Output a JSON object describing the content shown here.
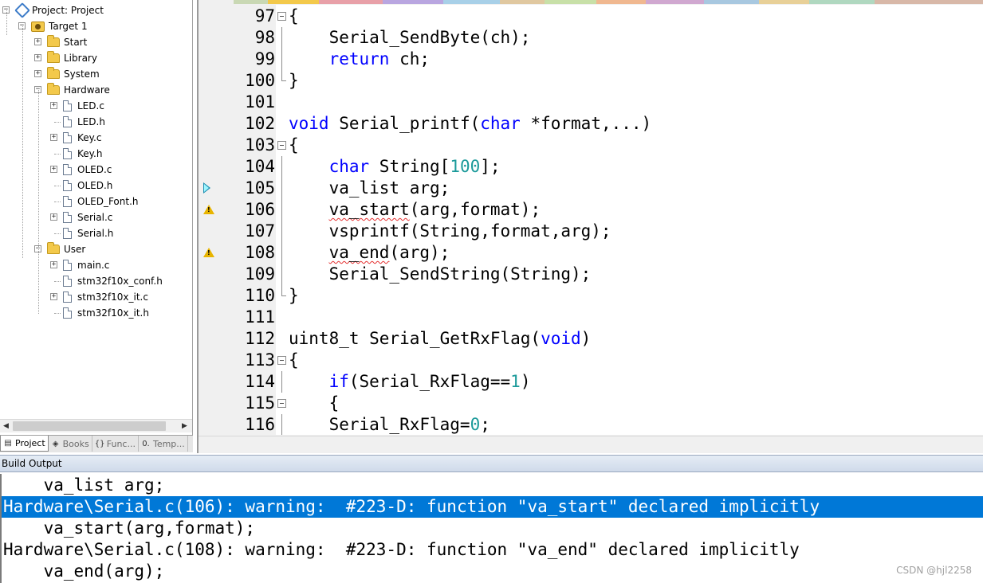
{
  "project_tree": {
    "items": [
      {
        "label": "Project: Project",
        "type": "project",
        "level": 0,
        "expander": "minus"
      },
      {
        "label": "Target 1",
        "type": "target",
        "level": 1,
        "expander": "minus"
      },
      {
        "label": "Start",
        "type": "folder",
        "level": 2,
        "expander": "plus"
      },
      {
        "label": "Library",
        "type": "folder",
        "level": 2,
        "expander": "plus"
      },
      {
        "label": "System",
        "type": "folder",
        "level": 2,
        "expander": "plus"
      },
      {
        "label": "Hardware",
        "type": "folder-open",
        "level": 2,
        "expander": "minus"
      },
      {
        "label": "LED.c",
        "type": "file",
        "level": 3,
        "expander": "plus"
      },
      {
        "label": "LED.h",
        "type": "file",
        "level": 3,
        "expander": "none"
      },
      {
        "label": "Key.c",
        "type": "file",
        "level": 3,
        "expander": "plus"
      },
      {
        "label": "Key.h",
        "type": "file",
        "level": 3,
        "expander": "none"
      },
      {
        "label": "OLED.c",
        "type": "file",
        "level": 3,
        "expander": "plus"
      },
      {
        "label": "OLED.h",
        "type": "file",
        "level": 3,
        "expander": "none"
      },
      {
        "label": "OLED_Font.h",
        "type": "file",
        "level": 3,
        "expander": "none"
      },
      {
        "label": "Serial.c",
        "type": "file",
        "level": 3,
        "expander": "plus"
      },
      {
        "label": "Serial.h",
        "type": "file",
        "level": 3,
        "expander": "none"
      },
      {
        "label": "User",
        "type": "folder-open",
        "level": 2,
        "expander": "minus"
      },
      {
        "label": "main.c",
        "type": "file",
        "level": 3,
        "expander": "plus"
      },
      {
        "label": "stm32f10x_conf.h",
        "type": "file",
        "level": 3,
        "expander": "none"
      },
      {
        "label": "stm32f10x_it.c",
        "type": "file",
        "level": 3,
        "expander": "plus"
      },
      {
        "label": "stm32f10x_it.h",
        "type": "file",
        "level": 3,
        "expander": "none"
      }
    ]
  },
  "panel_tabs": [
    {
      "label": "Project",
      "icon": "project-tab-icon",
      "active": true
    },
    {
      "label": "Books",
      "icon": "books-icon",
      "active": false
    },
    {
      "label": "Func...",
      "icon": "functions-icon",
      "active": false
    },
    {
      "label": "Temp...",
      "icon": "templates-icon",
      "active": false
    }
  ],
  "editor": {
    "tab_colors": [
      "#f0f0f0",
      "#c9d8b4",
      "#f3c94b",
      "#e8a0a8",
      "#b9a6e0",
      "#a8d0e8",
      "#e0c8a0",
      "#c8e0a8",
      "#f0b890",
      "#d0a8d0",
      "#a8c8e0",
      "#e8d098",
      "#b0d8c0",
      "#d8b8a8"
    ],
    "lines": [
      {
        "num": "97",
        "marker": "",
        "fold": "box",
        "tokens": [
          {
            "t": "{",
            "c": ""
          }
        ]
      },
      {
        "num": "98",
        "marker": "",
        "fold": "bar",
        "tokens": [
          {
            "t": "    Serial_SendByte(ch);",
            "c": ""
          }
        ]
      },
      {
        "num": "99",
        "marker": "",
        "fold": "bar",
        "tokens": [
          {
            "t": "    ",
            "c": ""
          },
          {
            "t": "return",
            "c": "kw"
          },
          {
            "t": " ch;",
            "c": ""
          }
        ]
      },
      {
        "num": "100",
        "marker": "",
        "fold": "end",
        "tokens": [
          {
            "t": "}",
            "c": ""
          }
        ]
      },
      {
        "num": "101",
        "marker": "",
        "fold": "",
        "tokens": [
          {
            "t": "",
            "c": ""
          }
        ]
      },
      {
        "num": "102",
        "marker": "",
        "fold": "",
        "tokens": [
          {
            "t": "void",
            "c": "kw"
          },
          {
            "t": " Serial_printf(",
            "c": ""
          },
          {
            "t": "char",
            "c": "kw"
          },
          {
            "t": " *format,...)",
            "c": ""
          }
        ]
      },
      {
        "num": "103",
        "marker": "",
        "fold": "box",
        "tokens": [
          {
            "t": "{",
            "c": ""
          }
        ]
      },
      {
        "num": "104",
        "marker": "",
        "fold": "bar",
        "tokens": [
          {
            "t": "    ",
            "c": ""
          },
          {
            "t": "char",
            "c": "kw"
          },
          {
            "t": " String[",
            "c": ""
          },
          {
            "t": "100",
            "c": "num"
          },
          {
            "t": "];",
            "c": ""
          }
        ]
      },
      {
        "num": "105",
        "marker": "arrow",
        "fold": "bar",
        "tokens": [
          {
            "t": "    va_list arg;",
            "c": ""
          }
        ]
      },
      {
        "num": "106",
        "marker": "warning",
        "fold": "bar",
        "tokens": [
          {
            "t": "    ",
            "c": ""
          },
          {
            "t": "va_start",
            "c": "squig"
          },
          {
            "t": "(arg,format);",
            "c": ""
          }
        ]
      },
      {
        "num": "107",
        "marker": "",
        "fold": "bar",
        "tokens": [
          {
            "t": "    vsprintf(String,format,arg);",
            "c": ""
          }
        ]
      },
      {
        "num": "108",
        "marker": "warning",
        "fold": "bar",
        "tokens": [
          {
            "t": "    ",
            "c": ""
          },
          {
            "t": "va_end",
            "c": "squig"
          },
          {
            "t": "(arg);",
            "c": ""
          }
        ]
      },
      {
        "num": "109",
        "marker": "",
        "fold": "bar",
        "tokens": [
          {
            "t": "    Serial_SendString(String);",
            "c": ""
          }
        ]
      },
      {
        "num": "110",
        "marker": "",
        "fold": "end",
        "tokens": [
          {
            "t": "}",
            "c": ""
          }
        ]
      },
      {
        "num": "111",
        "marker": "",
        "fold": "",
        "tokens": [
          {
            "t": "",
            "c": ""
          }
        ]
      },
      {
        "num": "112",
        "marker": "",
        "fold": "",
        "tokens": [
          {
            "t": "uint8_t Serial_GetRxFlag(",
            "c": ""
          },
          {
            "t": "void",
            "c": "kw"
          },
          {
            "t": ")",
            "c": ""
          }
        ]
      },
      {
        "num": "113",
        "marker": "",
        "fold": "box",
        "tokens": [
          {
            "t": "{",
            "c": ""
          }
        ]
      },
      {
        "num": "114",
        "marker": "",
        "fold": "bar",
        "tokens": [
          {
            "t": "    ",
            "c": ""
          },
          {
            "t": "if",
            "c": "kw"
          },
          {
            "t": "(Serial_RxFlag==",
            "c": ""
          },
          {
            "t": "1",
            "c": "num"
          },
          {
            "t": ")",
            "c": ""
          }
        ]
      },
      {
        "num": "115",
        "marker": "",
        "fold": "box",
        "tokens": [
          {
            "t": "    {",
            "c": ""
          }
        ]
      },
      {
        "num": "116",
        "marker": "",
        "fold": "bar",
        "tokens": [
          {
            "t": "    Serial_RxFlag=",
            "c": ""
          },
          {
            "t": "0",
            "c": "num"
          },
          {
            "t": ";",
            "c": ""
          }
        ]
      }
    ]
  },
  "build_output": {
    "title": "Build Output",
    "lines": [
      {
        "text": "    va_list arg;",
        "selected": false
      },
      {
        "text": "Hardware\\Serial.c(106): warning:  #223-D: function \"va_start\" declared implicitly",
        "selected": true
      },
      {
        "text": "    va_start(arg,format);",
        "selected": false
      },
      {
        "text": "Hardware\\Serial.c(108): warning:  #223-D: function \"va_end\" declared implicitly",
        "selected": false
      },
      {
        "text": "    va_end(arg);",
        "selected": false
      }
    ]
  },
  "watermark": "CSDN @hjl2258"
}
